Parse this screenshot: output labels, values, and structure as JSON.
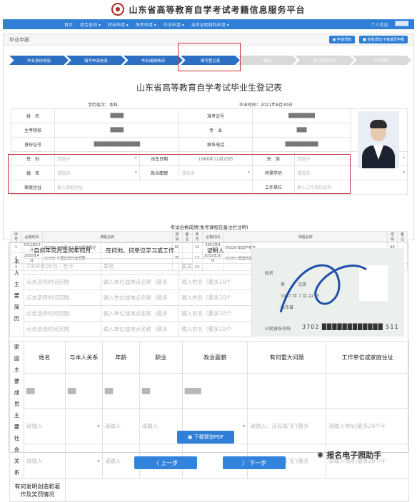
{
  "header": {
    "title": "山东省高等教育自学考试考籍信息服务平台"
  },
  "nav": {
    "items": [
      "首页",
      "综合查询 ▾",
      "转出申请 ▾",
      "免考申请 ▾",
      "毕业申请 ▾",
      "自考证明材料申请 ▾"
    ],
    "right": [
      "个人信息",
      "████"
    ]
  },
  "panel": {
    "crumb": "毕业申报",
    "btn1": "▣ 申请须知",
    "btn2": "■ 查看须知/下载填写申报"
  },
  "steps": [
    "毕业身份核验",
    "填写申请信息",
    "毕业成绩核审",
    "填写登记表",
    "缴费",
    "登记表预打印",
    "打印材料"
  ],
  "form_title": "山东省高等教育自学考试毕业生登记表",
  "meta": {
    "level": "学历层次：本科",
    "date": "毕业时间：2021年6月30日"
  },
  "rows": [
    {
      "l1": "姓　名",
      "v1": "████",
      "l2": "准考证号",
      "v2": "████████"
    },
    {
      "l1": "主考院校",
      "v1": "████",
      "l2": "专　业",
      "v2": "███"
    },
    {
      "l1": "身份证号",
      "v1": "██████████████",
      "l2": "联系电话",
      "v2": "██████████"
    }
  ],
  "edit": {
    "gender_l": "性　别",
    "gender": "请选择",
    "birth_l": "出生日期",
    "birth": "1988年12月25日",
    "nation_l": "民　族",
    "nation": "请选择",
    "marry_l": "婚　否",
    "marry": "请选择",
    "party_l": "政治面貌",
    "party": "请选择",
    "edu_l": "所需学历",
    "edu": "请选择",
    "addr_l": "家庭住址",
    "addr": "输入家庭住址",
    "work_l": "工作单位",
    "work": "输入工作单位名称"
  },
  "scores_title": "考试合格成绩(免考课程在备注栏注明)",
  "scores": {
    "header": [
      "序号",
      "合格时间",
      "课程名称",
      "成绩",
      "备注",
      "序号",
      "合格时间",
      "课程名称",
      "成绩",
      "备注"
    ],
    "rows": [
      [
        "1",
        "2011年10月",
        "00709 马克思主义基本原理概论",
        "60",
        "",
        "11",
        "2011年4月",
        "00226 知识产权法",
        "60",
        ""
      ],
      [
        "2",
        "2010年4月",
        "00706 中国近现代史纲要",
        "70",
        "",
        "12",
        "2011年10月",
        "05680 婚姻家庭法",
        "73",
        ""
      ],
      [
        "3",
        "",
        "",
        "",
        "",
        "13",
        "",
        "",
        "",
        ""
      ]
    ]
  },
  "resume": {
    "side": "本人主要简历",
    "col1": "自何年何月至何年何月",
    "col2": "在何地、何单位学习或工作",
    "col3": "证明人",
    "r1": [
      "2000年09月 - 至今",
      "某地",
      "某某"
    ],
    "ph1": "点击选择时间范围",
    "ph2": "输入单位或地点名称（最多",
    "ph3": "输入姓名（最多10个"
  },
  "idcard": {
    "name_l": "姓名",
    "sex": "男",
    "nation": "汉族",
    "birth": "1987 年 7 月 22 日",
    "addr_l": "山东省",
    "num_l": "公民身份号码",
    "num": "3702 ████████████ 511"
  },
  "family": {
    "side": "家庭主要成员主要社会关系",
    "cols": [
      "姓名",
      "与本人关系",
      "年龄",
      "职业",
      "政治面貌",
      "有何重大问题",
      "工作单位或家庭住址"
    ],
    "r1": [
      "██",
      "██",
      "██",
      "██",
      "████"
    ],
    "ph": "请输入",
    "ph_issue": "请输入，没有填'无'(最多",
    "ph_addr": "请输入地址(最多20个字"
  },
  "inventions": {
    "label": "有何发明创造和著作及奖罚情况"
  },
  "buttons": {
    "pdf": "▣ 下载预览PDF",
    "prev": "〈 上一步",
    "next": "〉 下一步"
  },
  "watermark": "报名电子照助手"
}
